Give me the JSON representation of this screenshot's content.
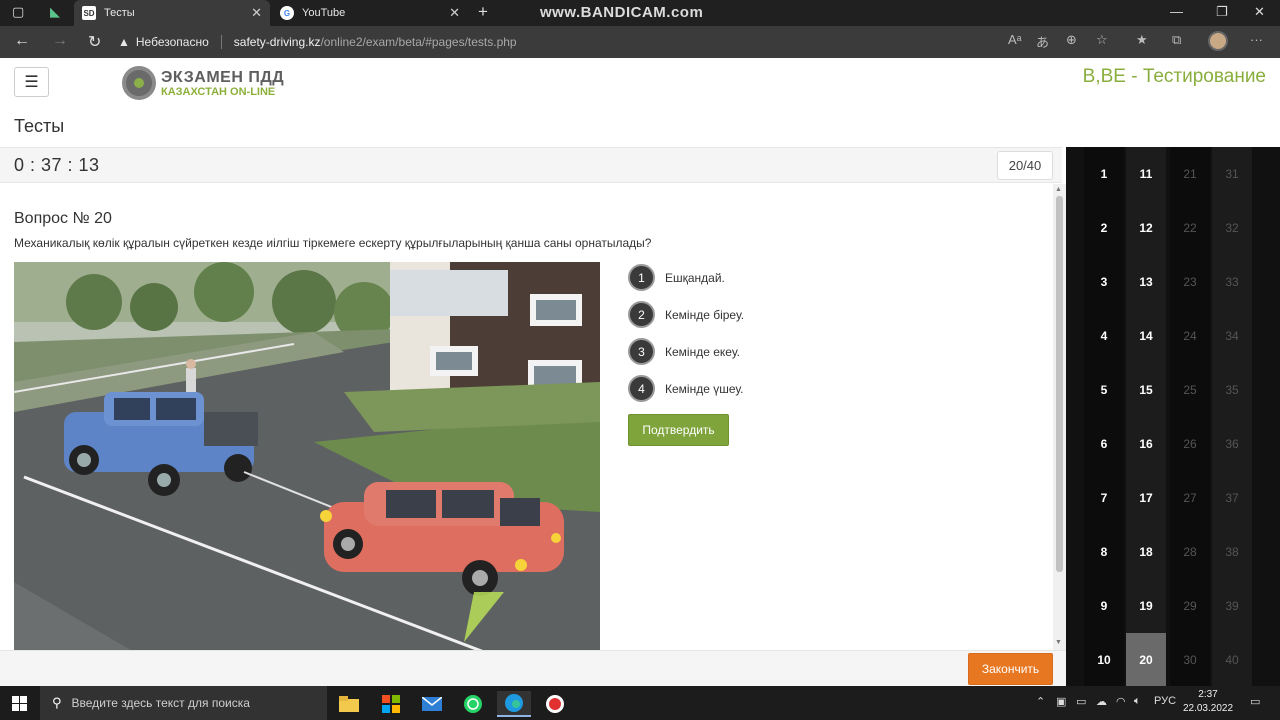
{
  "browser": {
    "tabs": [
      {
        "label": "Тесты",
        "active": true
      },
      {
        "label": "YouTube",
        "active": false
      }
    ],
    "tab1_badge": "SD",
    "watermark": "www.BANDICAM.com",
    "insecure_label": "Небезопасно",
    "url_host": "safety-driving.kz",
    "url_path": "/online2/exam/beta/#pages/tests.php"
  },
  "header": {
    "logo_line1": "ЭКЗАМЕН ПДД",
    "logo_line2": "КАЗАХСТАН ON-LINE",
    "title": "B,BE - Тестирование"
  },
  "page_title": "Тесты",
  "timer": "0 : 37 : 13",
  "progress": "20/40",
  "question": {
    "number_label": "Вопрос № 20",
    "text": "Механикалық көлік құралын сүйреткен кезде иілгіш тіркемеге ескерту құрылғыларының қанша саны орнатылады?",
    "answers": [
      {
        "num": "1",
        "text": "Ешқандай."
      },
      {
        "num": "2",
        "text": "Кемінде біреу."
      },
      {
        "num": "3",
        "text": "Кемінде екеу."
      },
      {
        "num": "4",
        "text": "Кемінде үшеу."
      }
    ],
    "confirm_label": "Подтвердить"
  },
  "finish_label": "Закончить",
  "question_nav": {
    "columns": [
      [
        "1",
        "2",
        "3",
        "4",
        "5",
        "6",
        "7",
        "8",
        "9",
        "10"
      ],
      [
        "11",
        "12",
        "13",
        "14",
        "15",
        "16",
        "17",
        "18",
        "19",
        "20"
      ],
      [
        "21",
        "22",
        "23",
        "24",
        "25",
        "26",
        "27",
        "28",
        "29",
        "30"
      ],
      [
        "31",
        "32",
        "33",
        "34",
        "35",
        "36",
        "37",
        "38",
        "39",
        "40"
      ]
    ],
    "current": "20",
    "answered_through": 19
  },
  "taskbar": {
    "search_placeholder": "Введите здесь текст для поиска",
    "language": "РУС",
    "time": "2:37",
    "date": "22.03.2022"
  },
  "colors": {
    "accent_green": "#7fa43c",
    "finish_orange": "#e87722",
    "header_green": "#8aae3e"
  }
}
